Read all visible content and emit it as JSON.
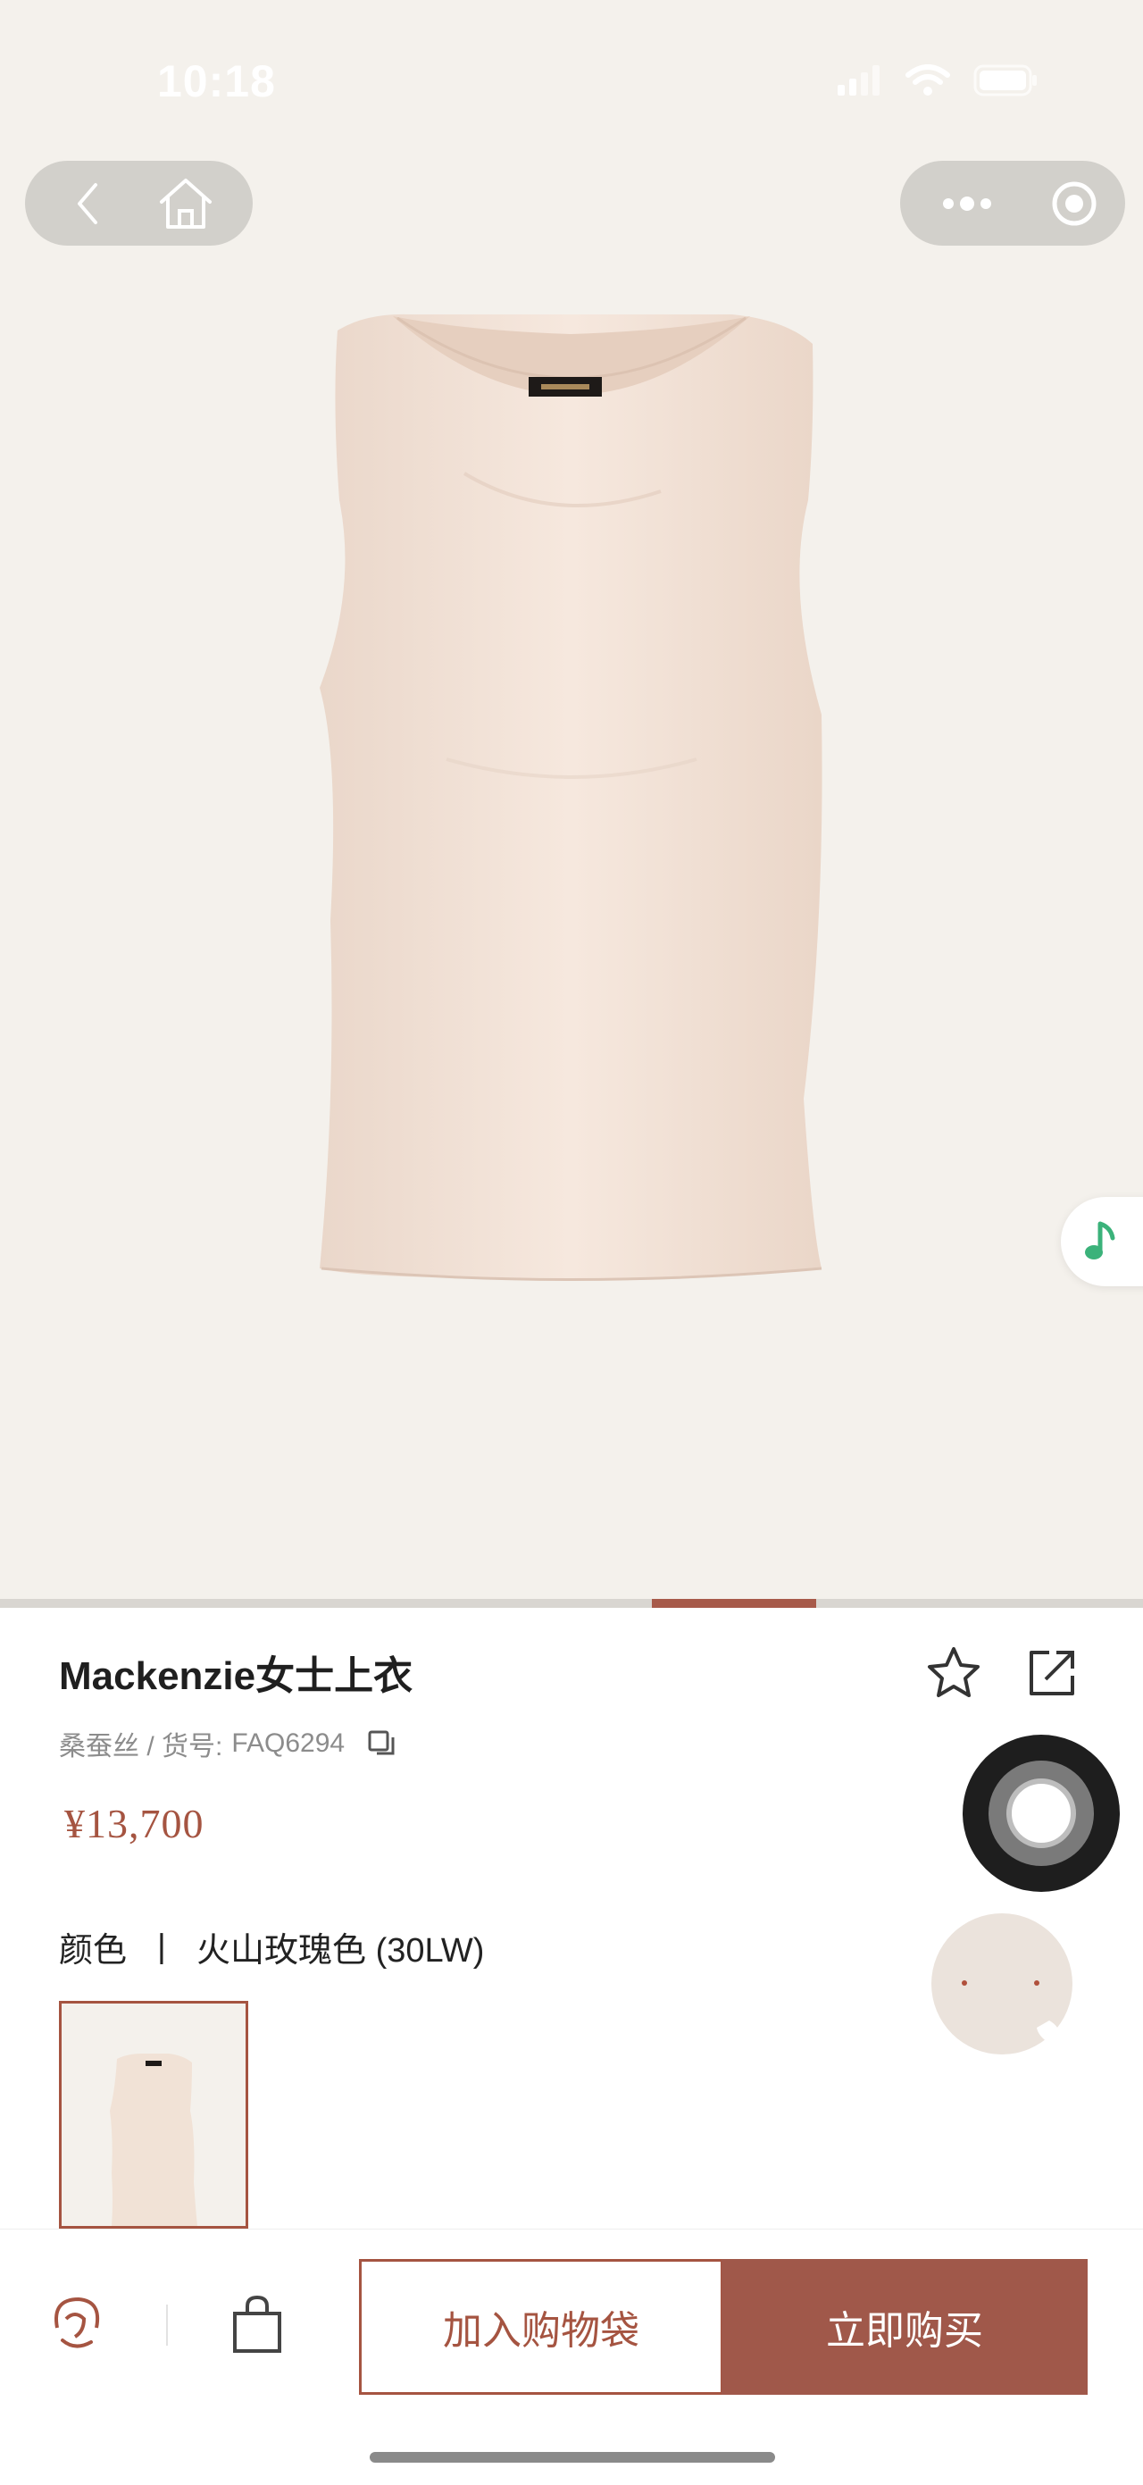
{
  "status_bar": {
    "time": "10:18"
  },
  "nav": {
    "back_icon": "chevron-left-icon",
    "home_icon": "home-icon",
    "more_icon": "more-dots-icon",
    "close_icon": "target-icon"
  },
  "product": {
    "title": "Mackenzie女士上衣",
    "material": "桑蚕丝 / 货号:",
    "sku": "FAQ6294",
    "price": "¥13,700",
    "color_label": "颜色",
    "color_separator": "丨",
    "color_value": "火山玫瑰色 (30LW)"
  },
  "gallery": {
    "active_index": 3,
    "total": 7
  },
  "bottom_bar": {
    "add_to_bag_label": "加入购物袋",
    "buy_now_label": "立即购买"
  },
  "colors": {
    "accent": "#a55441",
    "hero_bg": "#f4f1ec",
    "garment": "#f2e3d7"
  }
}
